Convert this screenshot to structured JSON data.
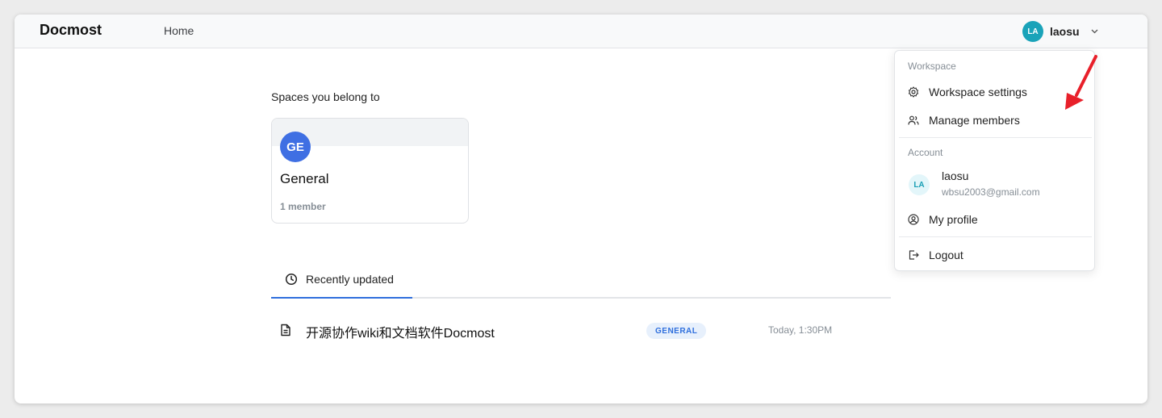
{
  "app": {
    "logo": "Docmost"
  },
  "nav": {
    "home": "Home"
  },
  "user": {
    "initials": "LA",
    "name": "laosu",
    "email": "wbsu2003@gmail.com"
  },
  "spaces": {
    "title": "Spaces you belong to",
    "items": [
      {
        "initials": "GE",
        "name": "General",
        "members": "1 member"
      }
    ]
  },
  "tabs": [
    {
      "label": "Recently updated",
      "icon": "clock-icon",
      "active": true
    }
  ],
  "recent_pages": [
    {
      "title": "开源协作wiki和文档软件Docmost",
      "space": "GENERAL",
      "updated": "Today, 1:30PM"
    }
  ],
  "dropdown": {
    "workspace_label": "Workspace",
    "workspace_settings": "Workspace settings",
    "manage_members": "Manage members",
    "account_label": "Account",
    "my_profile": "My profile",
    "logout": "Logout"
  },
  "colors": {
    "accent": "#2f6fdd",
    "avatar_teal": "#1aa3b9",
    "space_avatar": "#3f6fe3",
    "annotation_arrow": "#e8202a"
  }
}
